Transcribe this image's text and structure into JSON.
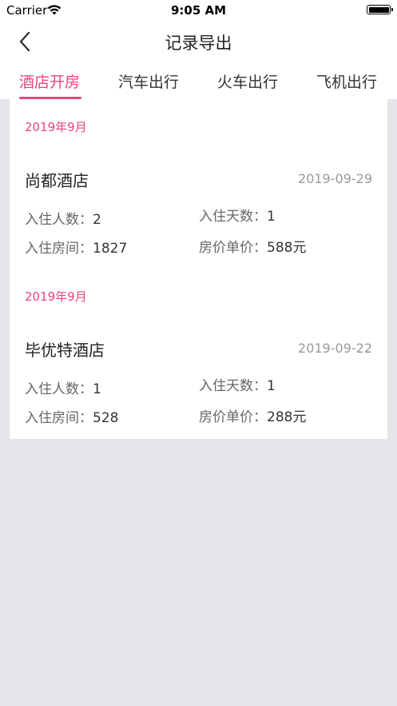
{
  "status_bar": {
    "carrier": "Carrier",
    "time": "9:05 AM"
  },
  "nav": {
    "title": "记录导出"
  },
  "tabs": [
    {
      "label": "酒店开房",
      "active": true
    },
    {
      "label": "汽车出行",
      "active": false
    },
    {
      "label": "火车出行",
      "active": false
    },
    {
      "label": "飞机出行",
      "active": false
    }
  ],
  "records": [
    {
      "month": "2019年9月",
      "hotel": "尚都酒店",
      "date": "2019-09-29",
      "guests_label": "入住人数：",
      "guests": "2",
      "days_label": "入住天数：",
      "days": "1",
      "room_label": "入住房间：",
      "room": "1827",
      "price_label": "房价单价：",
      "price": "588元"
    },
    {
      "month": "2019年9月",
      "hotel": "毕优特酒店",
      "date": "2019-09-22",
      "guests_label": "入住人数：",
      "guests": "1",
      "days_label": "入住天数：",
      "days": "1",
      "room_label": "入住房间：",
      "room": "528",
      "price_label": "房价单价：",
      "price": "288元"
    }
  ],
  "colors": {
    "accent": "#e8457d",
    "background": "#e5e5ea",
    "card": "#ffffff"
  }
}
